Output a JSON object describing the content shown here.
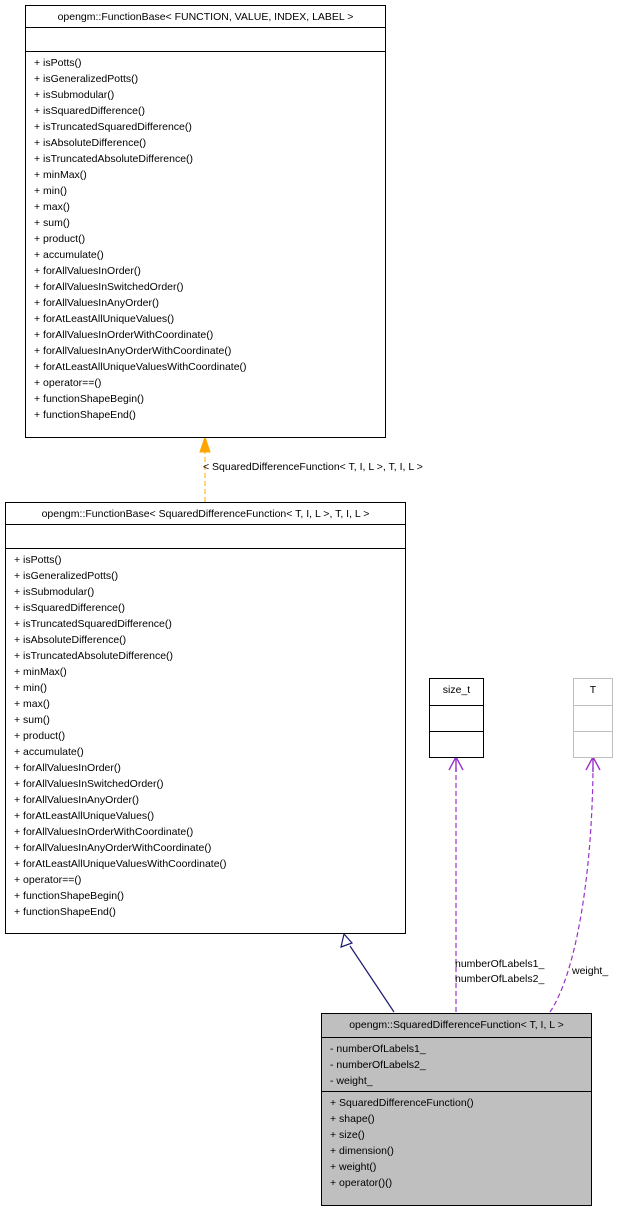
{
  "classes": {
    "base_generic": {
      "title": "opengm::FunctionBase< FUNCTION, VALUE, INDEX, LABEL >",
      "attributes": [],
      "methods": [
        "+ isPotts()",
        "+ isGeneralizedPotts()",
        "+ isSubmodular()",
        "+ isSquaredDifference()",
        "+ isTruncatedSquaredDifference()",
        "+ isAbsoluteDifference()",
        "+ isTruncatedAbsoluteDifference()",
        "+ minMax()",
        "+ min()",
        "+ max()",
        "+ sum()",
        "+ product()",
        "+ accumulate()",
        "+ forAllValuesInOrder()",
        "+ forAllValuesInSwitchedOrder()",
        "+ forAllValuesInAnyOrder()",
        "+ forAtLeastAllUniqueValues()",
        "+ forAllValuesInOrderWithCoordinate()",
        "+ forAllValuesInAnyOrderWithCoordinate()",
        "+ forAtLeastAllUniqueValuesWithCoordinate()",
        "+ operator==()",
        "+ functionShapeBegin()",
        "+ functionShapeEnd()"
      ]
    },
    "base_specialized": {
      "title": "opengm::FunctionBase< SquaredDifferenceFunction< T, I, L >, T, I, L >",
      "attributes": [],
      "methods": [
        "+ isPotts()",
        "+ isGeneralizedPotts()",
        "+ isSubmodular()",
        "+ isSquaredDifference()",
        "+ isTruncatedSquaredDifference()",
        "+ isAbsoluteDifference()",
        "+ isTruncatedAbsoluteDifference()",
        "+ minMax()",
        "+ min()",
        "+ max()",
        "+ sum()",
        "+ product()",
        "+ accumulate()",
        "+ forAllValuesInOrder()",
        "+ forAllValuesInSwitchedOrder()",
        "+ forAllValuesInAnyOrder()",
        "+ forAtLeastAllUniqueValues()",
        "+ forAllValuesInOrderWithCoordinate()",
        "+ forAllValuesInAnyOrderWithCoordinate()",
        "+ forAtLeastAllUniqueValuesWithCoordinate()",
        "+ operator==()",
        "+ functionShapeBegin()",
        "+ functionShapeEnd()"
      ]
    },
    "size_t": {
      "title": "size_t"
    },
    "T": {
      "title": "T"
    },
    "squared": {
      "title": "opengm::SquaredDifferenceFunction< T, I, L >",
      "attributes": [
        "- numberOfLabels1_",
        "- numberOfLabels2_",
        "- weight_"
      ],
      "methods": [
        "+ SquaredDifferenceFunction()",
        "+ shape()",
        "+ size()",
        "+ dimension()",
        "+ weight()",
        "+ operator()()"
      ]
    }
  },
  "edges": {
    "template_label": "< SquaredDifferenceFunction< T, I, L >, T, I, L >",
    "size_t_labels": [
      "numberOfLabels1_",
      "numberOfLabels2_"
    ],
    "T_label": "weight_"
  },
  "colors": {
    "template_edge": "#ffa500",
    "inheritance_edge": "#191970",
    "usage_edge": "#9a32cd",
    "highlight_fill": "#bfbfbf"
  }
}
